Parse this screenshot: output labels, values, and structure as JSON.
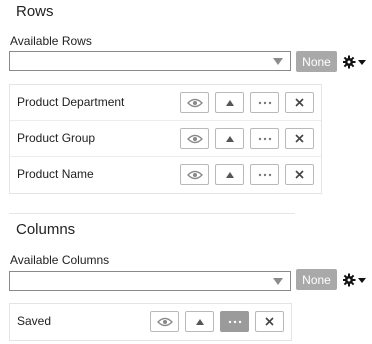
{
  "rows": {
    "title": "Rows",
    "available_label": "Available Rows",
    "available_value": "",
    "none_label": "None",
    "items": [
      {
        "label": "Product Department"
      },
      {
        "label": "Product Group"
      },
      {
        "label": "Product Name"
      }
    ]
  },
  "columns": {
    "title": "Columns",
    "available_label": "Available Columns",
    "available_value": "",
    "none_label": "None",
    "items": [
      {
        "label": "Saved"
      }
    ]
  },
  "icons": {
    "visibility": "eye-icon",
    "move_up": "up-arrow-icon",
    "more": "ellipsis-icon",
    "remove": "close-icon",
    "settings": "gear-icon",
    "dropdown": "chevron-down-icon"
  },
  "colors": {
    "none_button": "#a9a9a9",
    "active_button": "#9b9b9b"
  }
}
